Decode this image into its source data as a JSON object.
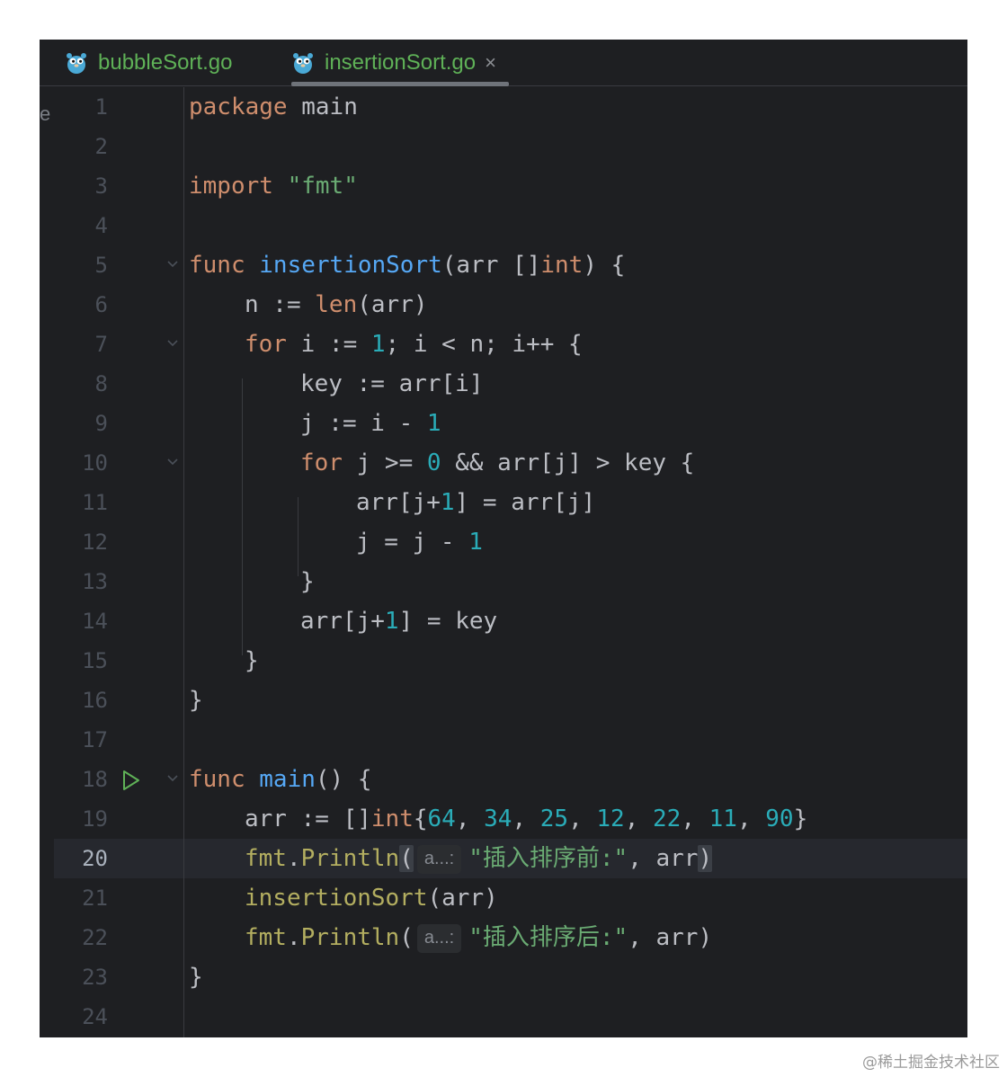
{
  "tabs": [
    {
      "label": "bubbleSort.go",
      "active": false
    },
    {
      "label": "insertionSort.go",
      "active": true
    }
  ],
  "tab_close_glyph": "×",
  "edge_char": "e",
  "current_line": "20",
  "line_numbers": [
    "1",
    "2",
    "3",
    "4",
    "5",
    "6",
    "7",
    "8",
    "9",
    "10",
    "11",
    "12",
    "13",
    "14",
    "15",
    "16",
    "17",
    "18",
    "19",
    "20",
    "21",
    "22",
    "23",
    "24"
  ],
  "code": {
    "l1_kw": "package",
    "l1_name": " main",
    "l3_kw": "import",
    "l3_str": " \"fmt\"",
    "l5_kw": "func",
    "l5_fn": " insertionSort",
    "l5_a": "(arr []",
    "l5_type": "int",
    "l5_b": ") {",
    "l6_a": "n := ",
    "l6_bi": "len",
    "l6_b": "(arr)",
    "l7_kw": "for",
    "l7_a": " i := ",
    "l7_n": "1",
    "l7_b": "; i < n; i++ {",
    "l8": "key := arr[i]",
    "l9_a": "j := i - ",
    "l9_n": "1",
    "l10_kw": "for",
    "l10_a": " j >= ",
    "l10_n": "0",
    "l10_b": " && arr[j] > key {",
    "l11_a": "arr[j+",
    "l11_n": "1",
    "l11_b": "] = arr[j]",
    "l12_a": "j = j - ",
    "l12_n": "1",
    "l13": "}",
    "l14_a": "arr[j+",
    "l14_n": "1",
    "l14_b": "] = key",
    "l15": "}",
    "l16": "}",
    "l18_kw": "func",
    "l18_fn": " main",
    "l18_b": "() {",
    "l19_a": "arr := []",
    "l19_type": "int",
    "l19_b": "{",
    "l19_nums": [
      "64",
      "34",
      "25",
      "12",
      "22",
      "11",
      "90"
    ],
    "l19_sep": ", ",
    "l19_c": "}",
    "l20_pkg": "fmt",
    "l20_dot": ".",
    "l20_fn": "Println",
    "l20_open": "(",
    "l20_hint": "a...:",
    "l20_str": "\"插入排序前:\"",
    "l20_rest": ", arr",
    "l20_close": ")",
    "l21_fn": "insertionSort",
    "l21_b": "(arr)",
    "l22_pkg": "fmt",
    "l22_dot": ".",
    "l22_fn": "Println",
    "l22_open": "(",
    "l22_hint": "a...:",
    "l22_str": "\"插入排序后:\"",
    "l22_rest": ", arr)",
    "l23": "}"
  },
  "colors": {
    "background": "#1e1f22",
    "keyword": "#cf8e6d",
    "function": "#56a8f5",
    "number": "#2aacb8",
    "string": "#6aab73",
    "tab_text": "#5fb157"
  },
  "icons": [
    "gopher-icon",
    "close-icon",
    "run-icon",
    "fold-arrow-icon"
  ],
  "watermark": "@稀土掘金技术社区"
}
